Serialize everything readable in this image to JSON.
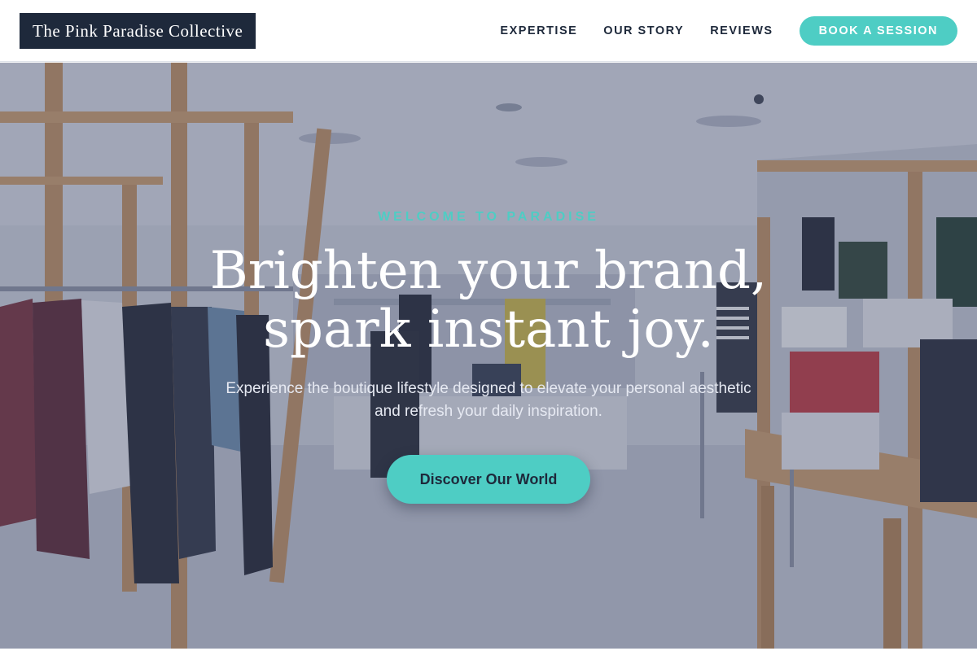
{
  "header": {
    "logo": "The Pink Paradise Collective",
    "nav": {
      "expertise": "EXPERTISE",
      "our_story": "OUR STORY",
      "reviews": "REVIEWS",
      "book": "BOOK A SESSION"
    }
  },
  "hero": {
    "eyebrow": "WELCOME TO PARADISE",
    "headline_line1": "Brighten your brand,",
    "headline_line2": "spark instant joy.",
    "subtext": "Experience the boutique lifestyle designed to elevate your personal aesthetic and refresh your daily inspiration.",
    "cta": "Discover Our World"
  },
  "colors": {
    "accent": "#4ecdc4",
    "dark": "#1e293b",
    "white": "#ffffff"
  }
}
